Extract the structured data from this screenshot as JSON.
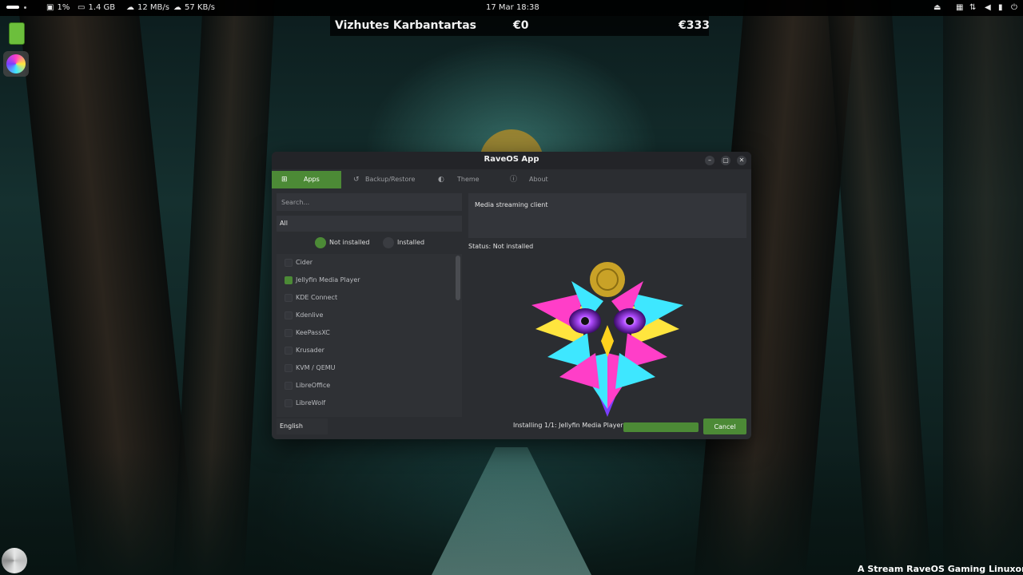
{
  "topbar": {
    "cpu": "1%",
    "memory": "1.4 GB",
    "download": "12 MB/s",
    "upload": "57 KB/s",
    "datetime": "17 Mar  18:38",
    "icons": [
      "workspace-indicator",
      "cpu-icon",
      "memory-icon",
      "download-icon",
      "upload-icon",
      "eject-icon",
      "settings-icon",
      "network-icon",
      "volume-icon",
      "power-icon"
    ]
  },
  "overlay": {
    "name": "Vizhutes Karbantartas",
    "amount_left": "€0",
    "amount_right": "€333"
  },
  "window": {
    "title": "RaveOS App",
    "tabs": [
      {
        "label": "Apps",
        "icon": "grid-icon",
        "active": true
      },
      {
        "label": "Backup/Restore",
        "icon": "history-icon",
        "active": false
      },
      {
        "label": "Theme",
        "icon": "palette-icon",
        "active": false
      },
      {
        "label": "About",
        "icon": "info-icon",
        "active": false
      }
    ],
    "search_placeholder": "Search...",
    "category": "All",
    "filter": {
      "not_installed": "Not installed",
      "installed": "Installed"
    },
    "apps": [
      {
        "label": "Cider",
        "checked": false
      },
      {
        "label": "Jellyfin Media Player",
        "checked": true
      },
      {
        "label": "KDE Connect",
        "checked": false
      },
      {
        "label": "Kdenlive",
        "checked": false
      },
      {
        "label": "KeePassXC",
        "checked": false
      },
      {
        "label": "Krusader",
        "checked": false
      },
      {
        "label": "KVM / QEMU",
        "checked": false
      },
      {
        "label": "LibreOffice",
        "checked": false
      },
      {
        "label": "LibreWolf",
        "checked": false
      }
    ],
    "description": "Media streaming client",
    "status": "Status: Not installed",
    "language": "English",
    "install_status": "Installing 1/1: Jellyfin Media Player",
    "progress": 1.0,
    "cancel_label": "Cancel"
  },
  "ticker": "A Stream RaveOS Gaming Linuxon fut",
  "colors": {
    "accent": "#4c8a36",
    "window_bg": "#2b2d31",
    "panel": "#33353a"
  }
}
